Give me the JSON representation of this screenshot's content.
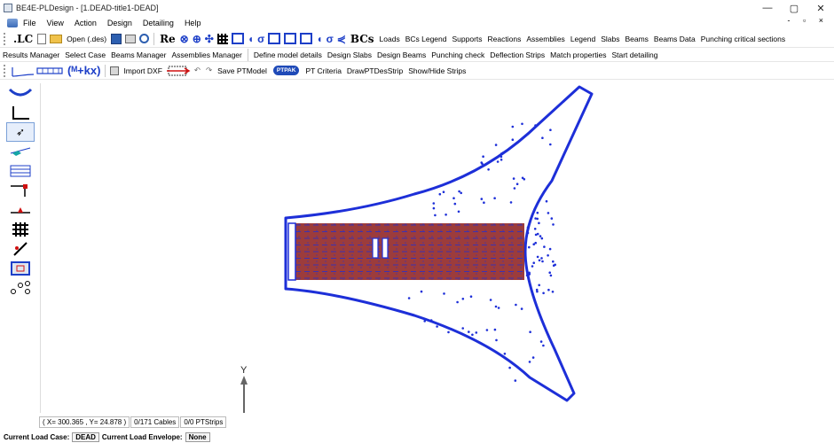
{
  "window": {
    "title": "BE4E-PLDesign - [1.DEAD-title1-DEAD]",
    "controls": [
      "—",
      "▢",
      "✕"
    ],
    "mdi_controls": "- ▫ ×"
  },
  "menu": [
    "File",
    "View",
    "Action",
    "Design",
    "Detailing",
    "Help"
  ],
  "toolbar1": {
    "lc": ".LC",
    "open": "Open (.des)",
    "re": "Re",
    "bcs": "BCs",
    "text_buttons": [
      "Loads",
      "BCs Legend",
      "Supports",
      "Reactions",
      "Assemblies",
      "Legend",
      "Slabs",
      "Beams",
      "Beams Data",
      "Punching critical sections"
    ]
  },
  "toolbar2": [
    "Results Manager",
    "Select Case",
    "Beams Manager",
    "Assemblies Manager",
    "Define model details",
    "Design Slabs",
    "Design Beams",
    "Punching check",
    "Deflection Strips",
    "Match properties",
    "Start detailing"
  ],
  "toolbar3": {
    "formula": "(ᴹ+kx)",
    "import_dxf": "Import DXF",
    "save_ptmodel": "Save PTModel",
    "ptpak": "PTPAK",
    "pt_criteria": "PT Criteria",
    "draw_pt": "DrawPTDesStrip",
    "show_hide": "Show/Hide Strips"
  },
  "canvas": {
    "axis_label": "Y",
    "colors": {
      "slab": "#1d2fd8",
      "strip": "#8b1a1a"
    }
  },
  "status": {
    "coords": "( X= 300.365 , Y= 24.878 )",
    "cables": "0/171 Cables",
    "strips": "0/0 PTStrips"
  },
  "loadbar": {
    "case_label": "Current Load Case:",
    "case_value": "DEAD",
    "envelope_label": "Current Load Envelope:",
    "envelope_value": "None"
  }
}
